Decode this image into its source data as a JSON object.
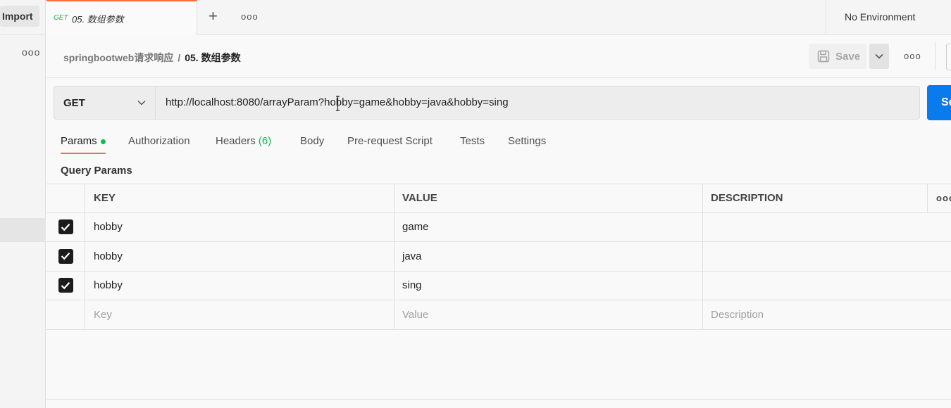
{
  "sidebar": {
    "import_label": "Import",
    "more_label": "ooo"
  },
  "tabbar": {
    "active_tab": {
      "method": "GET",
      "title": "05. 数组参数"
    },
    "new_tab_label": "+",
    "more_label": "ooo",
    "environment": "No Environment"
  },
  "breadcrumb": {
    "parent": "springbootweb请求响应",
    "separator": "/",
    "current": "05. 数组参数"
  },
  "toolbar": {
    "save_label": "Save",
    "more_label": "ooo"
  },
  "request": {
    "method": "GET",
    "url": "http://localhost:8080/arrayParam?hobby=game&hobby=java&hobby=sing",
    "send_label": "Se"
  },
  "subtabs": {
    "params": "Params",
    "authorization": "Authorization",
    "headers": "Headers",
    "headers_count": "(6)",
    "body": "Body",
    "prerequest": "Pre-request Script",
    "tests": "Tests",
    "settings": "Settings"
  },
  "query_params": {
    "label": "Query Params",
    "columns": {
      "key": "KEY",
      "value": "VALUE",
      "description": "DESCRIPTION",
      "more": "ooo"
    },
    "rows": [
      {
        "key": "hobby",
        "value": "game",
        "description": ""
      },
      {
        "key": "hobby",
        "value": "java",
        "description": ""
      },
      {
        "key": "hobby",
        "value": "sing",
        "description": ""
      }
    ],
    "placeholders": {
      "key": "Key",
      "value": "Value",
      "description": "Description"
    }
  },
  "colors": {
    "accent": "#ff6c37",
    "send": "#097bed",
    "status_green": "#0cbb52"
  }
}
